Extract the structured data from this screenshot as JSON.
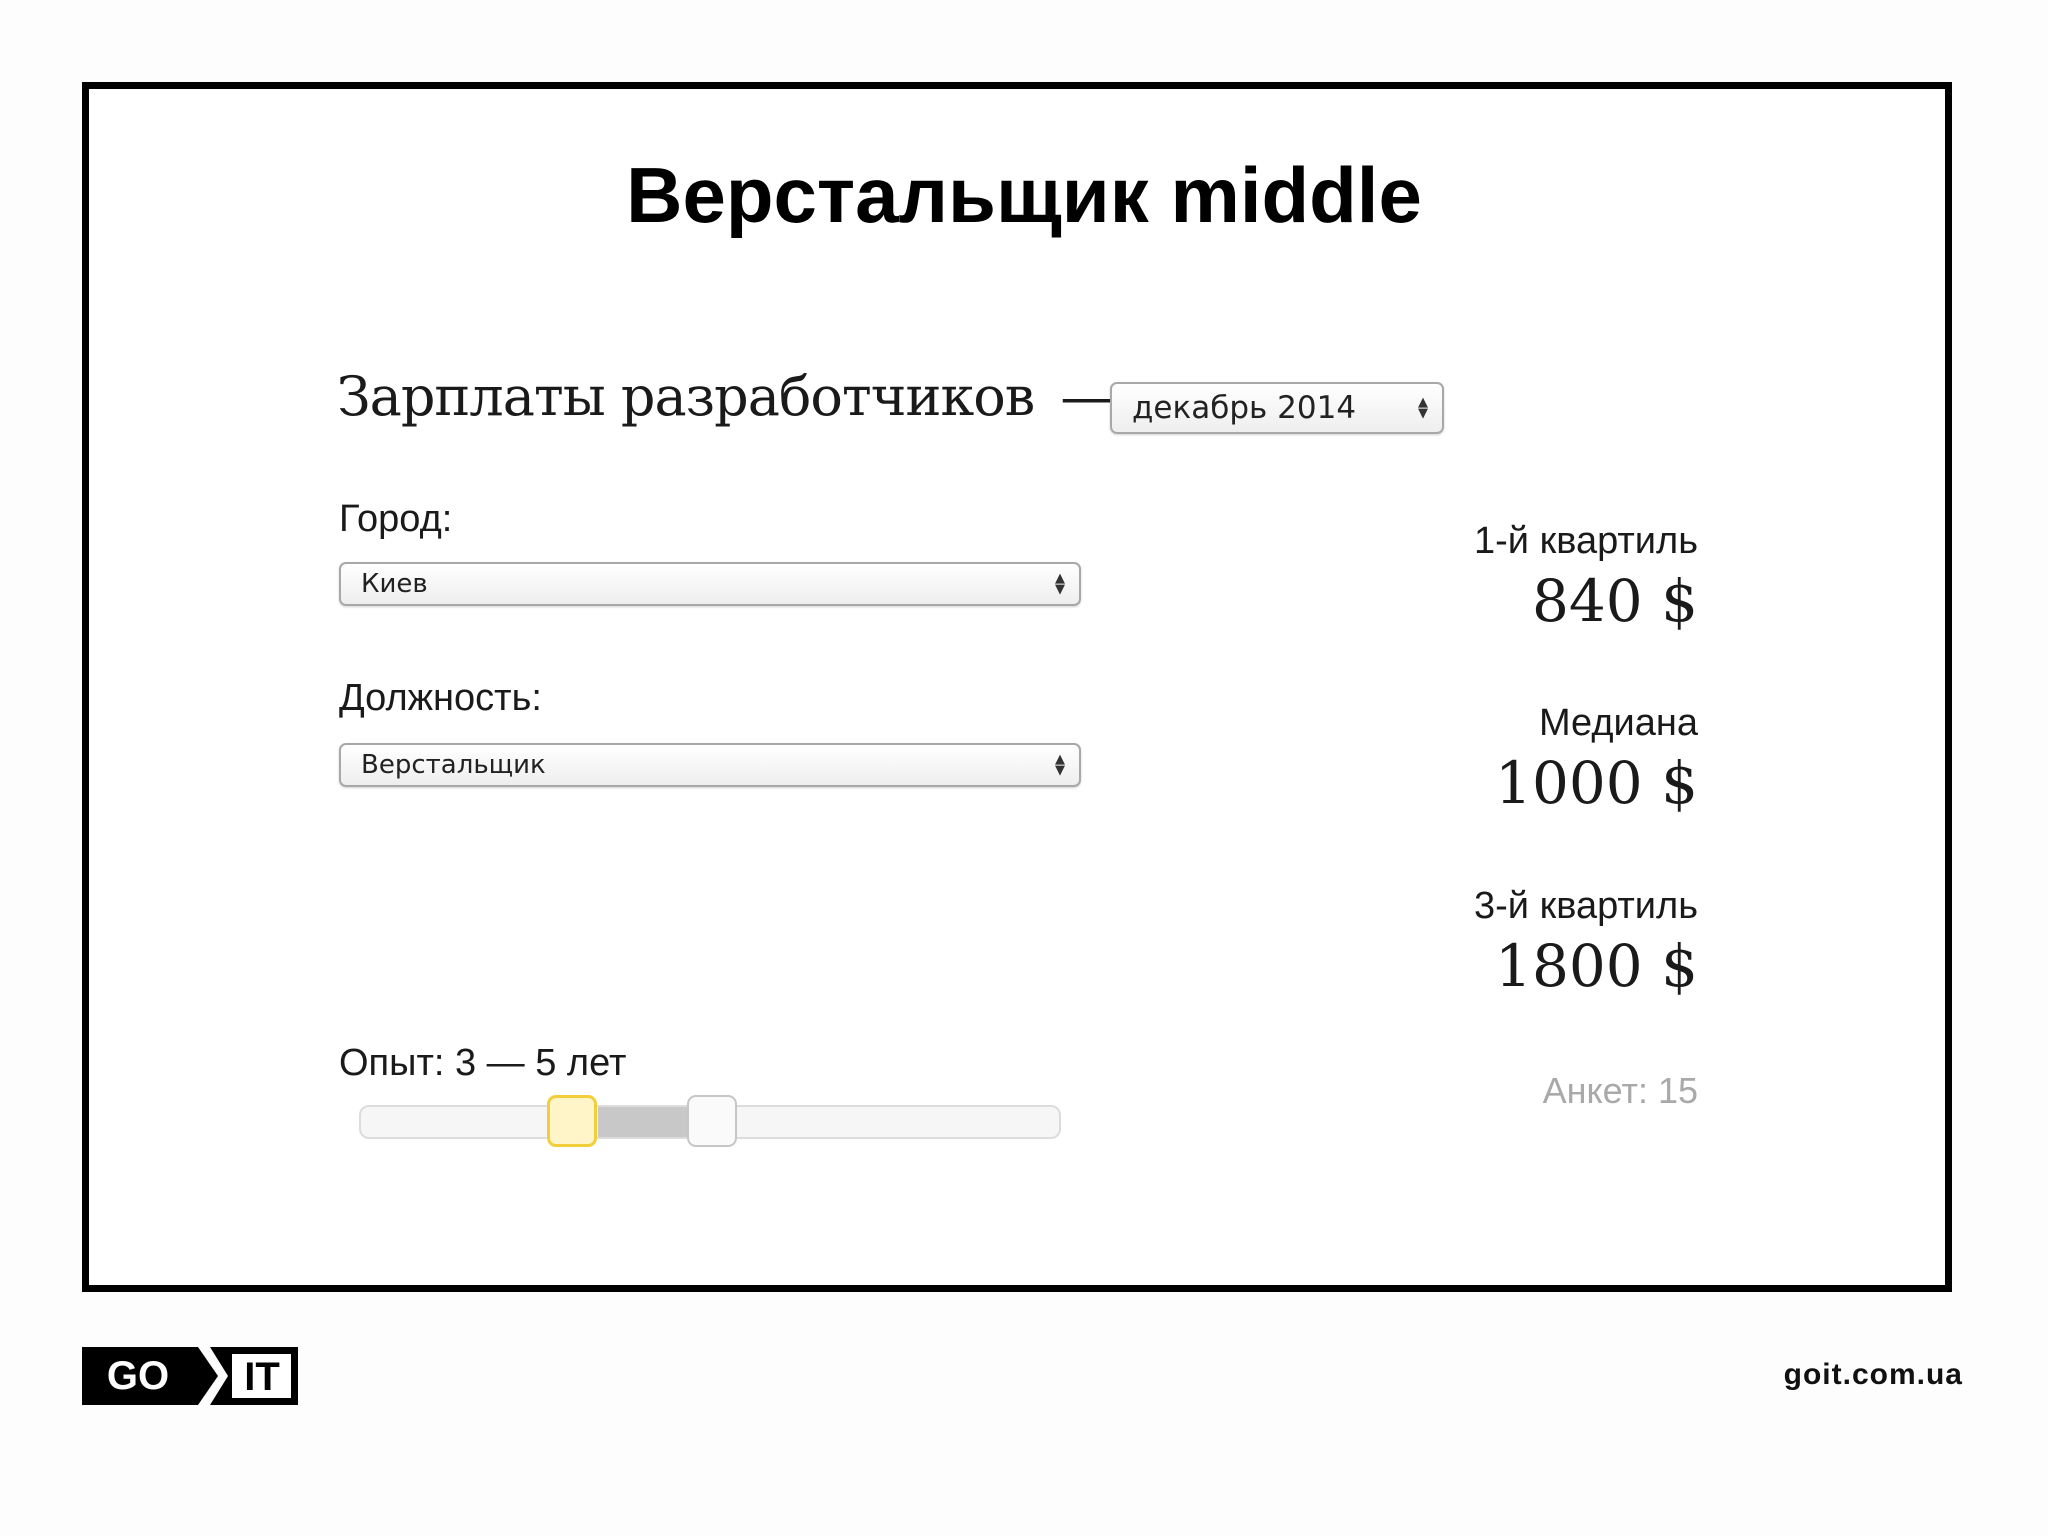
{
  "slide": {
    "title": "Верстальщик middle"
  },
  "widget": {
    "heading": "Зарплаты разработчиков",
    "heading_dash": "—",
    "month_select": {
      "value": "декабрь 2014"
    },
    "city": {
      "label": "Город:",
      "value": "Киев"
    },
    "position": {
      "label": "Должность:",
      "value": "Верстальщик"
    },
    "experience": {
      "label": "Опыт: 3 — 5 лет",
      "min_fraction": 0.33,
      "max_fraction": 0.55
    },
    "stats": {
      "q1_label": "1-й квартиль",
      "q1_value": "840 $",
      "median_label": "Медиана",
      "median_value": "1000 $",
      "q3_label": "3-й квартиль",
      "q3_value": "1800 $"
    },
    "surveys": "Анкет: 15"
  },
  "footer": {
    "logo_left": "GO",
    "logo_right": "IT",
    "site": "goit.com.ua"
  },
  "colors": {
    "frame": "#000000",
    "slider_active_handle": "#f2cf3a",
    "slider_range": "#c8c8c8",
    "muted_text": "#a9a9a9"
  }
}
